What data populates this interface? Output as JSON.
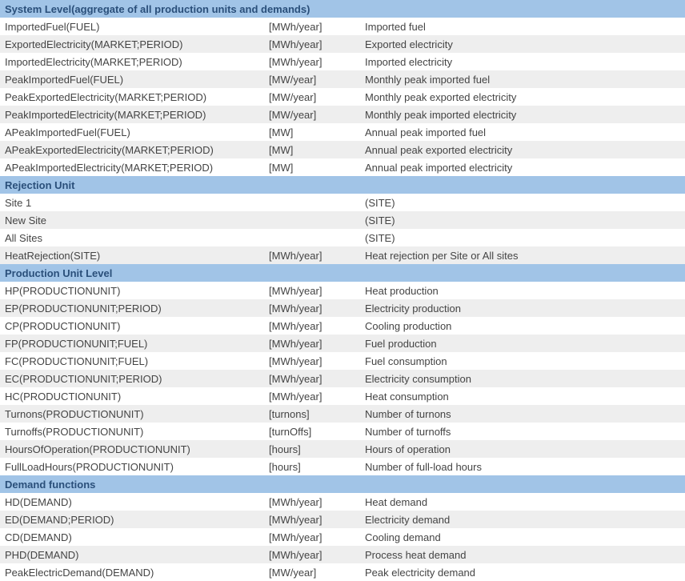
{
  "sections": [
    {
      "title": "System Level(aggregate of all production units and demands)",
      "rows": [
        {
          "name": "ImportedFuel(FUEL)",
          "unit": "[MWh/year]",
          "desc": "Imported fuel"
        },
        {
          "name": "ExportedElectricity(MARKET;PERIOD)",
          "unit": "[MWh/year]",
          "desc": "Exported electricity"
        },
        {
          "name": "ImportedElectricity(MARKET;PERIOD)",
          "unit": "[MWh/year]",
          "desc": "Imported electricity"
        },
        {
          "name": "PeakImportedFuel(FUEL)",
          "unit": "[MW/year]",
          "desc": "Monthly peak imported fuel"
        },
        {
          "name": "PeakExportedElectricity(MARKET;PERIOD)",
          "unit": "[MW/year]",
          "desc": "Monthly peak exported electricity"
        },
        {
          "name": "PeakImportedElectricity(MARKET;PERIOD)",
          "unit": "[MW/year]",
          "desc": "Monthly peak imported electricity"
        },
        {
          "name": "APeakImportedFuel(FUEL)",
          "unit": "[MW]",
          "desc": "Annual peak imported fuel"
        },
        {
          "name": "APeakExportedElectricity(MARKET;PERIOD)",
          "unit": "[MW]",
          "desc": "Annual peak exported electricity"
        },
        {
          "name": "APeakImportedElectricity(MARKET;PERIOD)",
          "unit": "[MW]",
          "desc": "Annual peak imported electricity"
        }
      ]
    },
    {
      "title": "Rejection Unit",
      "rows": [
        {
          "name": "Site 1",
          "unit": "",
          "desc": "(SITE)"
        },
        {
          "name": "New Site",
          "unit": "",
          "desc": "(SITE)"
        },
        {
          "name": "All Sites",
          "unit": "",
          "desc": "(SITE)"
        },
        {
          "name": "HeatRejection(SITE)",
          "unit": "[MWh/year]",
          "desc": "Heat rejection per Site or All sites"
        }
      ]
    },
    {
      "title": "Production Unit Level",
      "rows": [
        {
          "name": "HP(PRODUCTIONUNIT)",
          "unit": "[MWh/year]",
          "desc": "Heat production"
        },
        {
          "name": "EP(PRODUCTIONUNIT;PERIOD)",
          "unit": "[MWh/year]",
          "desc": "Electricity production"
        },
        {
          "name": "CP(PRODUCTIONUNIT)",
          "unit": "[MWh/year]",
          "desc": "Cooling production"
        },
        {
          "name": "FP(PRODUCTIONUNIT;FUEL)",
          "unit": "[MWh/year]",
          "desc": "Fuel production"
        },
        {
          "name": "FC(PRODUCTIONUNIT;FUEL)",
          "unit": "[MWh/year]",
          "desc": "Fuel consumption"
        },
        {
          "name": "EC(PRODUCTIONUNIT;PERIOD)",
          "unit": "[MWh/year]",
          "desc": "Electricity consumption"
        },
        {
          "name": "HC(PRODUCTIONUNIT)",
          "unit": "[MWh/year]",
          "desc": "Heat consumption"
        },
        {
          "name": "Turnons(PRODUCTIONUNIT)",
          "unit": "[turnons]",
          "desc": "Number of turnons"
        },
        {
          "name": "Turnoffs(PRODUCTIONUNIT)",
          "unit": "[turnOffs]",
          "desc": "Number of turnoffs"
        },
        {
          "name": "HoursOfOperation(PRODUCTIONUNIT)",
          "unit": "[hours]",
          "desc": "Hours of operation"
        },
        {
          "name": "FullLoadHours(PRODUCTIONUNIT)",
          "unit": "[hours]",
          "desc": "Number of full-load hours"
        }
      ]
    },
    {
      "title": "Demand functions",
      "rows": [
        {
          "name": "HD(DEMAND)",
          "unit": "[MWh/year]",
          "desc": "Heat demand"
        },
        {
          "name": "ED(DEMAND;PERIOD)",
          "unit": "[MWh/year]",
          "desc": "Electricity demand"
        },
        {
          "name": "CD(DEMAND)",
          "unit": "[MWh/year]",
          "desc": "Cooling demand"
        },
        {
          "name": "PHD(DEMAND)",
          "unit": "[MWh/year]",
          "desc": "Process heat demand"
        },
        {
          "name": "PeakElectricDemand(DEMAND)",
          "unit": "[MW/year]",
          "desc": "Peak electricity demand"
        }
      ]
    }
  ]
}
